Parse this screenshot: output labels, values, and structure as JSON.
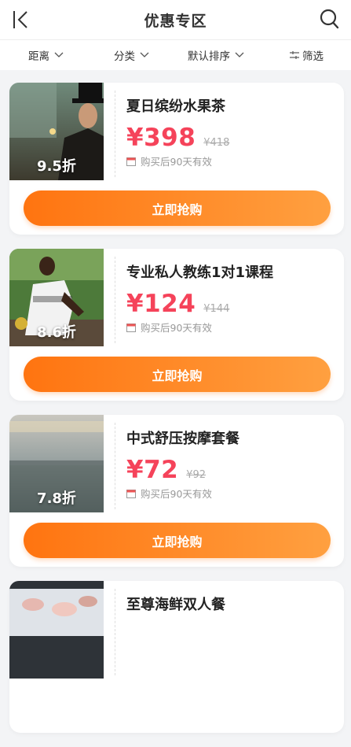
{
  "header": {
    "title": "优惠专区"
  },
  "filters": [
    {
      "label": "距离"
    },
    {
      "label": "分类"
    },
    {
      "label": "默认排序"
    },
    {
      "label": "筛选"
    }
  ],
  "cards": [
    {
      "name": "夏日缤纷水果茶",
      "price": "¥398",
      "original": "¥418",
      "discount": "9.5折",
      "validity": "购买后90天有效",
      "button": "立即抢购"
    },
    {
      "name": "专业私人教练1对1课程",
      "price": "¥124",
      "original": "¥144",
      "discount": "8.6折",
      "validity": "购买后90天有效",
      "button": "立即抢购"
    },
    {
      "name": "中式舒压按摩套餐",
      "price": "¥72",
      "original": "¥92",
      "discount": "7.8折",
      "validity": "购买后90天有效",
      "button": "立即抢购"
    },
    {
      "name": "至尊海鲜双人餐"
    }
  ]
}
